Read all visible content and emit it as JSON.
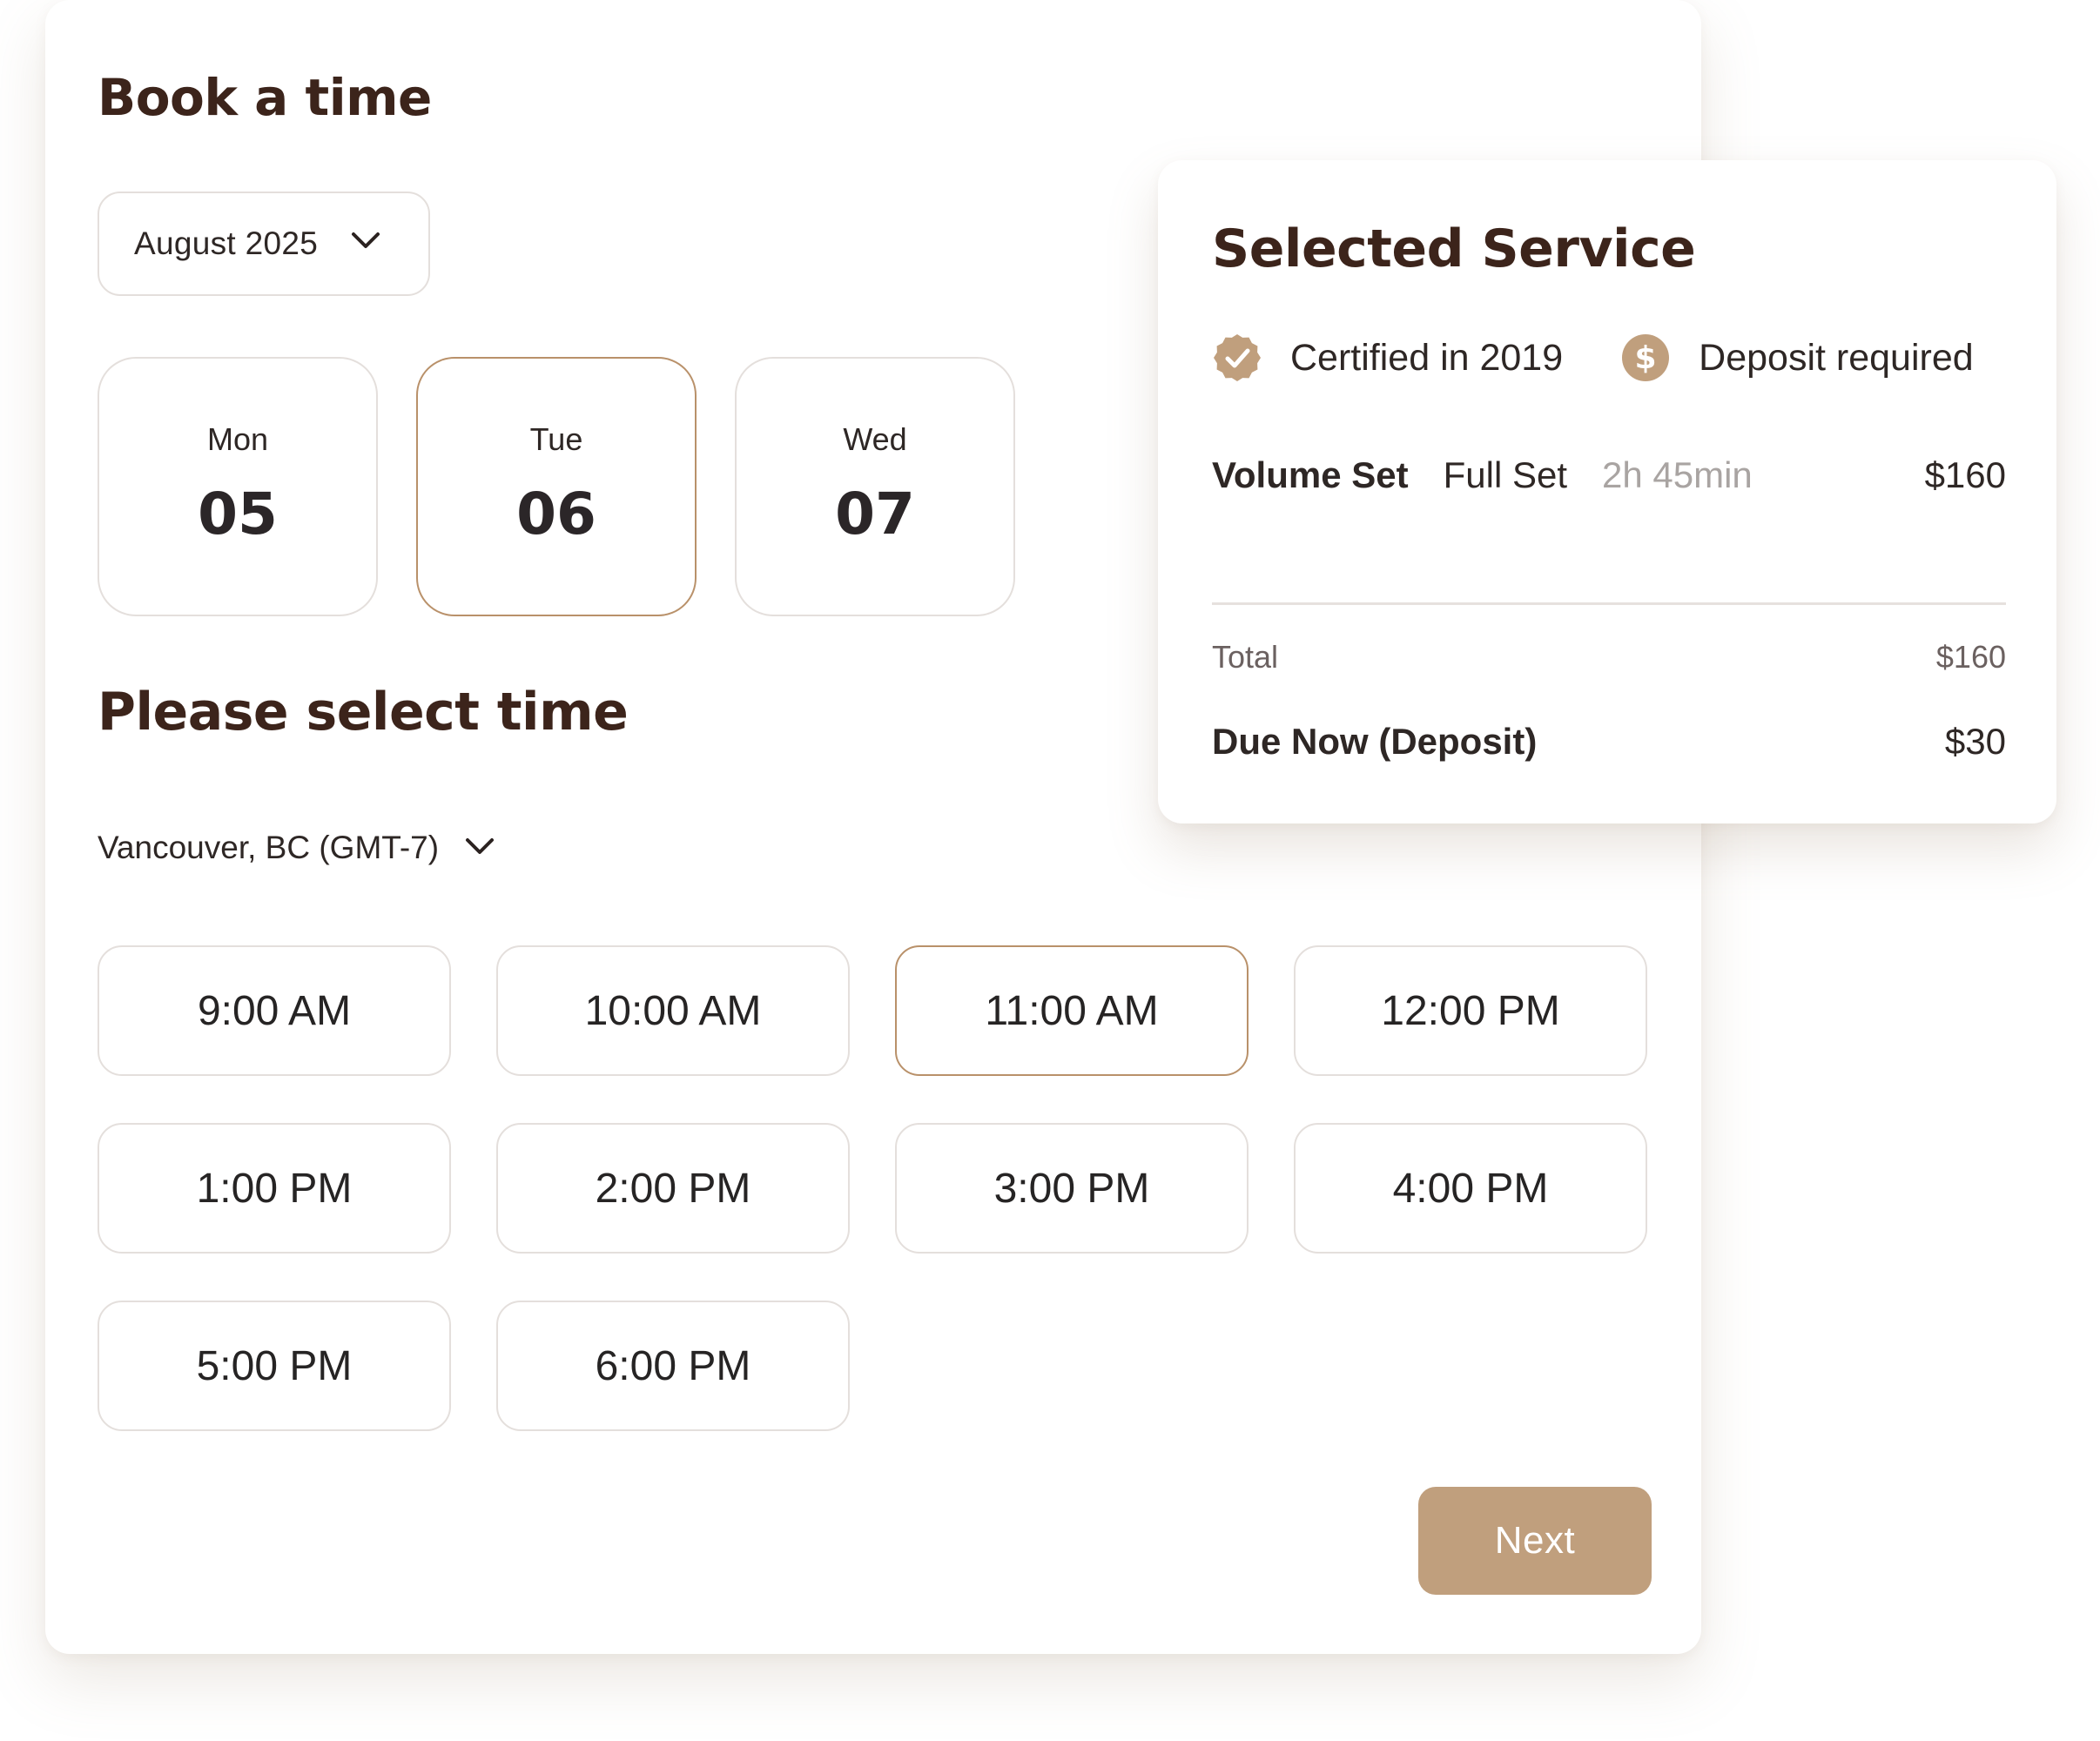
{
  "colors": {
    "heading": "#3c241b",
    "accent": "#c09f7d",
    "selected_border": "#b9916a",
    "border": "#e4dfdc",
    "muted_text": "#a9a4a2"
  },
  "booking": {
    "title": "Book a time",
    "month": {
      "value": "August 2025",
      "icon": "chevron-down-icon"
    },
    "days": [
      {
        "dow": "Mon",
        "num": "05",
        "selected": false
      },
      {
        "dow": "Tue",
        "num": "06",
        "selected": true
      },
      {
        "dow": "Wed",
        "num": "07",
        "selected": false
      }
    ],
    "time_heading": "Please select time",
    "timezone": {
      "value": "Vancouver, BC (GMT-7)",
      "icon": "chevron-down-icon"
    },
    "slots": [
      {
        "label": "9:00 AM",
        "selected": false
      },
      {
        "label": "10:00 AM",
        "selected": false
      },
      {
        "label": "11:00 AM",
        "selected": true
      },
      {
        "label": "12:00 PM",
        "selected": false
      },
      {
        "label": "1:00 PM",
        "selected": false
      },
      {
        "label": "2:00 PM",
        "selected": false
      },
      {
        "label": "3:00 PM",
        "selected": false
      },
      {
        "label": "4:00 PM",
        "selected": false
      },
      {
        "label": "5:00 PM",
        "selected": false
      },
      {
        "label": "6:00 PM",
        "selected": false
      }
    ],
    "next_label": "Next"
  },
  "service": {
    "title": "Selected Service",
    "badges": [
      {
        "icon": "verified-badge-icon",
        "text": "Certified in 2019"
      },
      {
        "icon": "dollar-coin-icon",
        "text": "Deposit required"
      }
    ],
    "item": {
      "name": "Volume Set",
      "option": "Full Set",
      "duration": "2h 45min",
      "price": "$160"
    },
    "total_label": "Total",
    "total_value": "$160",
    "due_label": "Due Now (Deposit)",
    "due_value": "$30"
  }
}
